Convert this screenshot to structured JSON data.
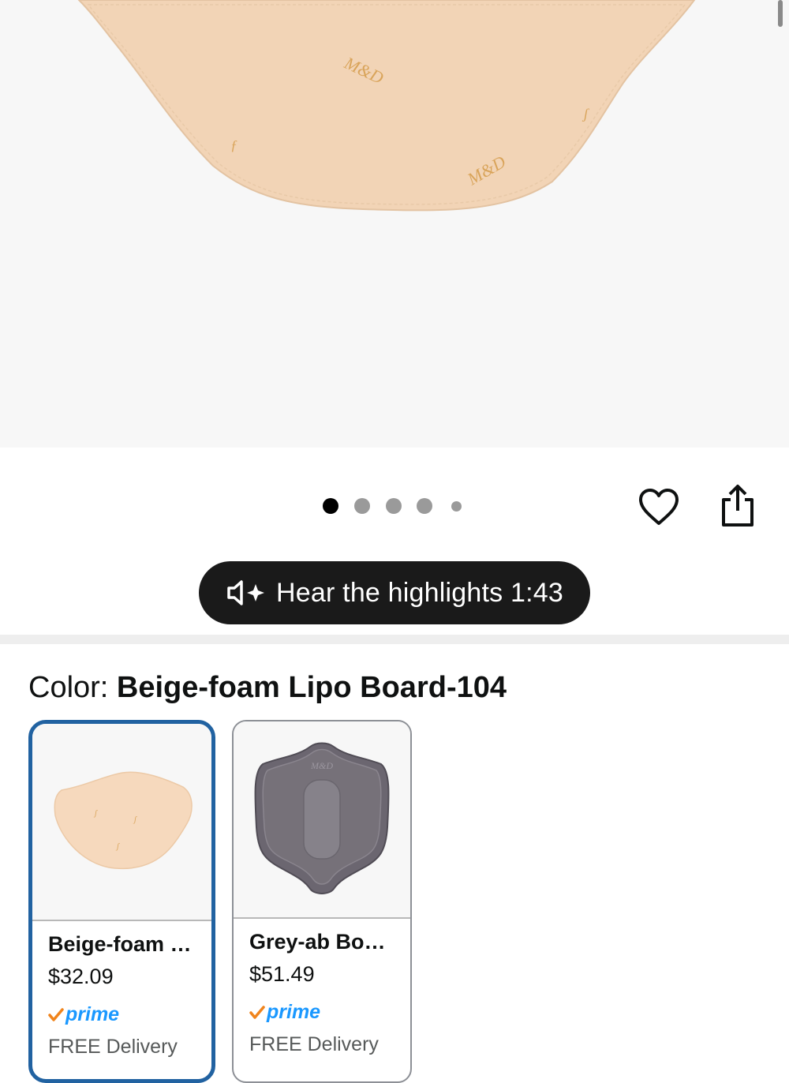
{
  "product_image": {
    "logo_text": "M&D"
  },
  "carousel": {
    "count": 5,
    "active_index": 0
  },
  "actions": {
    "favorite_icon": "heart-icon",
    "share_icon": "share-icon"
  },
  "audio": {
    "label": "Hear the highlights 1:43",
    "icon": "speaker-sparkle-icon"
  },
  "color_selector": {
    "label": "Color: ",
    "selected_value": "Beige-foam Lipo Board-104",
    "options": [
      {
        "name": "Beige-foam …",
        "price": "$32.09",
        "prime": "prime",
        "delivery": "FREE Delivery",
        "selected": true
      },
      {
        "name": "Grey-ab Bo…",
        "price": "$51.49",
        "prime": "prime",
        "delivery": "FREE Delivery",
        "selected": false
      }
    ]
  },
  "colors": {
    "selected_border": "#2162a1",
    "prime_blue": "#1a98ff",
    "prime_check": "#f0841c",
    "pill_bg": "#1a1a1a",
    "beige": "#f2d3b5",
    "grey": "#6b6670"
  }
}
